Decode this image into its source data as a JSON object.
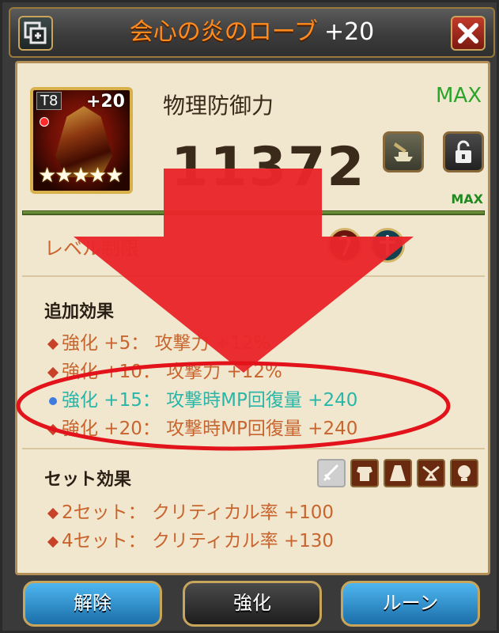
{
  "title": {
    "name": "会心の炎のローブ",
    "plus": "+20"
  },
  "item": {
    "tier": "T8",
    "plus": "+20",
    "stars": "★★★★★"
  },
  "stat": {
    "label": "物理防御力",
    "max": "MAX",
    "value": "11372"
  },
  "exp_bar": {
    "max_label": "MAX",
    "level": 1.0
  },
  "level_limit": {
    "label": "レベル制限"
  },
  "additional_effects": {
    "title": "追加効果",
    "lines": [
      "強化 +5： 攻撃力 +12%",
      "強化 +10： 攻撃力 +12%",
      "強化 +15： 攻撃時MP回復量 +240",
      "強化 +20： 攻撃時MP回復量 +240"
    ]
  },
  "set_effects": {
    "title": "セット効果",
    "lines": [
      "2セット： クリティカル率 +100",
      "4セット： クリティカル率 +130"
    ]
  },
  "buttons": {
    "release": "解除",
    "enhance": "強化",
    "rune": "ルーン"
  },
  "colors": {
    "title": "#ff8a1e",
    "effect": "#c8652e",
    "active_effect": "#29b6a8",
    "max": "#2aa52a",
    "arrow": "#e8262b"
  },
  "icons": [
    "expand-icon",
    "close-icon",
    "anvil-icon",
    "lock-icon",
    "class-icon-1",
    "class-icon-2",
    "sword-icon",
    "armor-icon",
    "robe-icon",
    "amulet-icon",
    "orb-icon"
  ]
}
